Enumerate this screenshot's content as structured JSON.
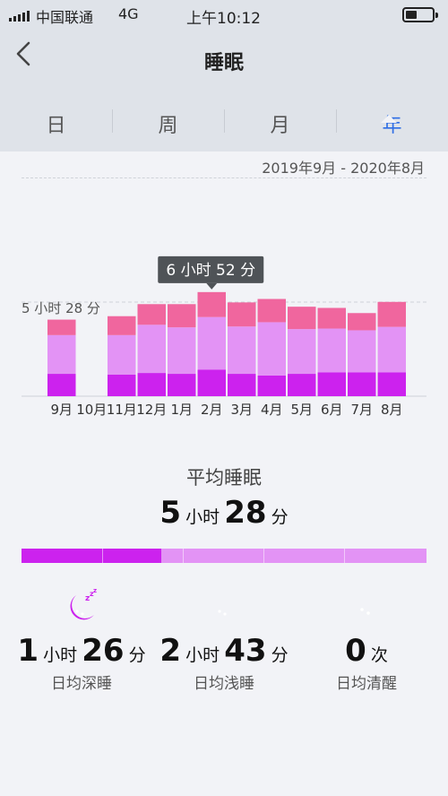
{
  "status_bar": {
    "carrier": "中国联通",
    "network": "4G",
    "time": "上午10:12"
  },
  "header": {
    "title": "睡眠",
    "tabs": [
      {
        "label": "日"
      },
      {
        "label": "周"
      },
      {
        "label": "月"
      },
      {
        "label": "年",
        "active": true
      }
    ]
  },
  "date_range": "2019年9月 - 2020年8月",
  "tooltip": "6 小时 52 分",
  "avg_line_label": "5 小时 28 分",
  "summary": {
    "label": "平均睡眠",
    "hours": "5",
    "hours_unit": "小时",
    "minutes": "28",
    "minutes_unit": "分"
  },
  "stats": [
    {
      "icon": "zzz-moon-icon",
      "color": "#cc22ee",
      "value1": "1",
      "unit1": "小时",
      "value2": "26",
      "unit2": "分",
      "label": "日均深睡"
    },
    {
      "icon": "moon-icon",
      "color": "#e393f5",
      "value1": "2",
      "unit1": "小时",
      "value2": "43",
      "unit2": "分",
      "label": "日均浅睡"
    },
    {
      "icon": "moon-icon",
      "color": "#f7b72c",
      "value1": "0",
      "unit1": "次",
      "label": "日均清醒"
    }
  ],
  "ratio": [
    {
      "name": "深睡",
      "fraction": 0.345,
      "color": "#cc22ee"
    },
    {
      "name": "浅睡",
      "fraction": 0.655,
      "color": "#e393f5"
    }
  ],
  "colors": {
    "deep": "#cc22ee",
    "light": "#e393f5",
    "rem": "#f0669e",
    "accent": "#2f6ee5"
  },
  "chart_data": {
    "type": "bar",
    "stacked": true,
    "categories": [
      "9月",
      "10月",
      "11月",
      "12月",
      "1月",
      "2月",
      "3月",
      "4月",
      "5月",
      "6月",
      "7月",
      "8月"
    ],
    "series": [
      {
        "values": [
          1.3,
          0,
          1.25,
          1.35,
          1.3,
          1.55,
          1.3,
          1.2,
          1.3,
          1.38,
          1.38,
          1.38
        ]
      },
      {
        "values": [
          2.25,
          0,
          2.3,
          2.8,
          2.7,
          3.05,
          2.75,
          3.1,
          2.6,
          2.55,
          2.45,
          2.65
        ]
      },
      {
        "values": [
          0.9,
          0,
          1.1,
          1.2,
          1.35,
          1.45,
          1.4,
          1.35,
          1.3,
          1.2,
          1.0,
          1.45
        ]
      }
    ],
    "average_line": 5.47,
    "highlight": {
      "category": "2月",
      "label": "6 小时 52 分"
    },
    "ylim": [
      0,
      8
    ],
    "grid": false
  }
}
